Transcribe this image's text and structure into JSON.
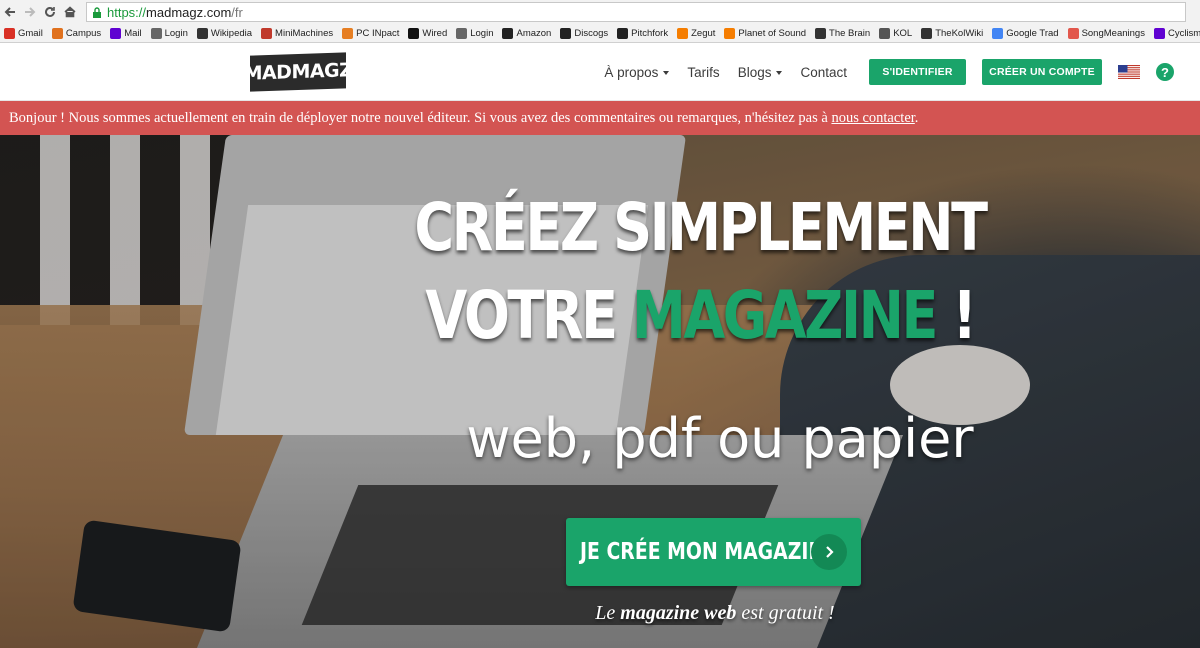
{
  "browser": {
    "url_protocol": "https://",
    "url_host": "madmagz.com",
    "url_path": "/fr",
    "bookmarks": [
      {
        "label": "Gmail",
        "icon": "gmail-icon",
        "color": "#d93025"
      },
      {
        "label": "Campus",
        "icon": "campus-icon",
        "color": "#e0711d"
      },
      {
        "label": "Mail",
        "icon": "yahoo-icon",
        "color": "#5f01d1"
      },
      {
        "label": "Login",
        "icon": "login-icon",
        "color": "#666666"
      },
      {
        "label": "Wikipedia",
        "icon": "wikipedia-icon",
        "color": "#333333"
      },
      {
        "label": "MiniMachines",
        "icon": "minimachines-icon",
        "color": "#c0392b"
      },
      {
        "label": "PC INpact",
        "icon": "pcinpact-icon",
        "color": "#e67e22"
      },
      {
        "label": "Wired",
        "icon": "wired-icon",
        "color": "#111111"
      },
      {
        "label": "Login",
        "icon": "login-icon",
        "color": "#666666"
      },
      {
        "label": "Amazon",
        "icon": "amazon-icon",
        "color": "#222222"
      },
      {
        "label": "Discogs",
        "icon": "discogs-icon",
        "color": "#222222"
      },
      {
        "label": "Pitchfork",
        "icon": "pitchfork-icon",
        "color": "#222222"
      },
      {
        "label": "Zegut",
        "icon": "blogger-icon",
        "color": "#f57d00"
      },
      {
        "label": "Planet of Sound",
        "icon": "blogger-icon",
        "color": "#f57d00"
      },
      {
        "label": "The Brain",
        "icon": "thebrain-icon",
        "color": "#333333"
      },
      {
        "label": "KOL",
        "icon": "kol-icon",
        "color": "#555555"
      },
      {
        "label": "TheKolWiki",
        "icon": "kolwiki-icon",
        "color": "#333333"
      },
      {
        "label": "Google Trad",
        "icon": "translate-icon",
        "color": "#4285f4"
      },
      {
        "label": "SongMeanings",
        "icon": "songmeanings-icon",
        "color": "#e2574c"
      },
      {
        "label": "Cyclisme",
        "icon": "yahoo-icon",
        "color": "#5f01d1"
      }
    ]
  },
  "header": {
    "logo_text": "MADMAGZ",
    "nav": {
      "about": "À propos",
      "pricing": "Tarifs",
      "blogs": "Blogs",
      "contact": "Contact"
    },
    "login_label": "S'IDENTIFIER",
    "signup_label": "CRÉER UN COMPTE",
    "help_label": "?"
  },
  "alert": {
    "text": "Bonjour ! Nous sommes actuellement en train de déployer notre nouvel éditeur. Si vous avez des commentaires ou remarques, n'hésitez pas à ",
    "link_text": "nous contacter",
    "suffix": "."
  },
  "hero": {
    "headline_line1": "CRÉEZ SIMPLEMENT",
    "headline_line2_prefix": "VOTRE ",
    "headline_line2_highlight": "MAGAZINE",
    "headline_line2_suffix": " !",
    "subheadline": "web, pdf ou papier",
    "cta_label": "JE CRÉE MON MAGAZINE",
    "free_note_prefix": "Le ",
    "free_note_bold": "magazine web",
    "free_note_suffix": " est gratuit !"
  },
  "colors": {
    "brand_green": "#1aa46a",
    "alert_red": "#d35452"
  }
}
